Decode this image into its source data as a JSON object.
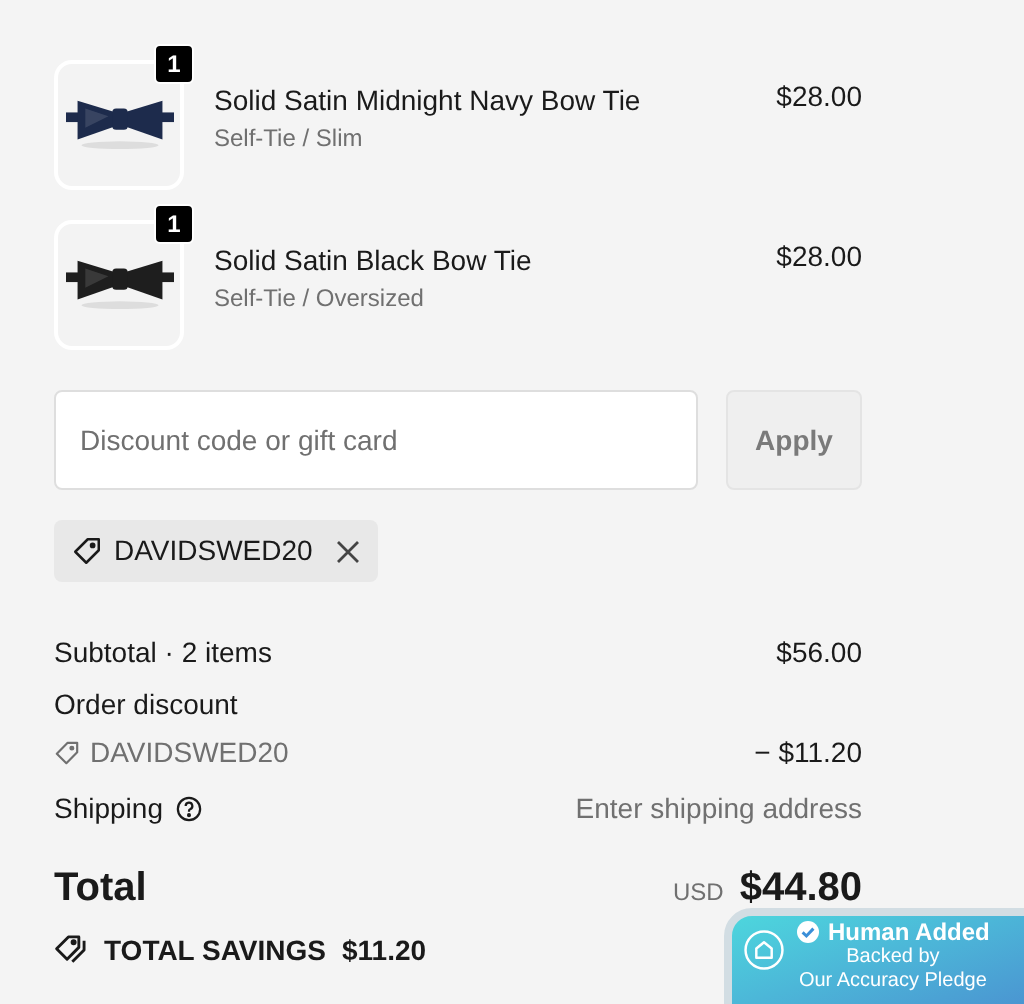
{
  "line_items": [
    {
      "quantity": "1",
      "name": "Solid Satin Midnight Navy Bow Tie",
      "variant": "Self-Tie / Slim",
      "price": "$28.00",
      "color": "#1d2b4c"
    },
    {
      "quantity": "1",
      "name": "Solid Satin Black Bow Tie",
      "variant": "Self-Tie / Oversized",
      "price": "$28.00",
      "color": "#1e1e1e"
    }
  ],
  "discount": {
    "placeholder": "Discount code or gift card",
    "button": "Apply",
    "disabled": true
  },
  "applied_code": "DAVIDSWED20",
  "summary": {
    "subtotal_label": "Subtotal · 2 items",
    "subtotal": "$56.00",
    "discount_label": "Order discount",
    "discount_code": "DAVIDSWED20",
    "discount_amount": "− $11.20",
    "shipping_label": "Shipping",
    "shipping_value": "Enter shipping address",
    "total_label": "Total",
    "currency": "USD",
    "total": "$44.80",
    "savings_label": "TOTAL SAVINGS",
    "savings": "$11.20"
  },
  "overlay": {
    "title": "Human Added",
    "lines": [
      "Backed by",
      "Our Accuracy Pledge"
    ]
  }
}
